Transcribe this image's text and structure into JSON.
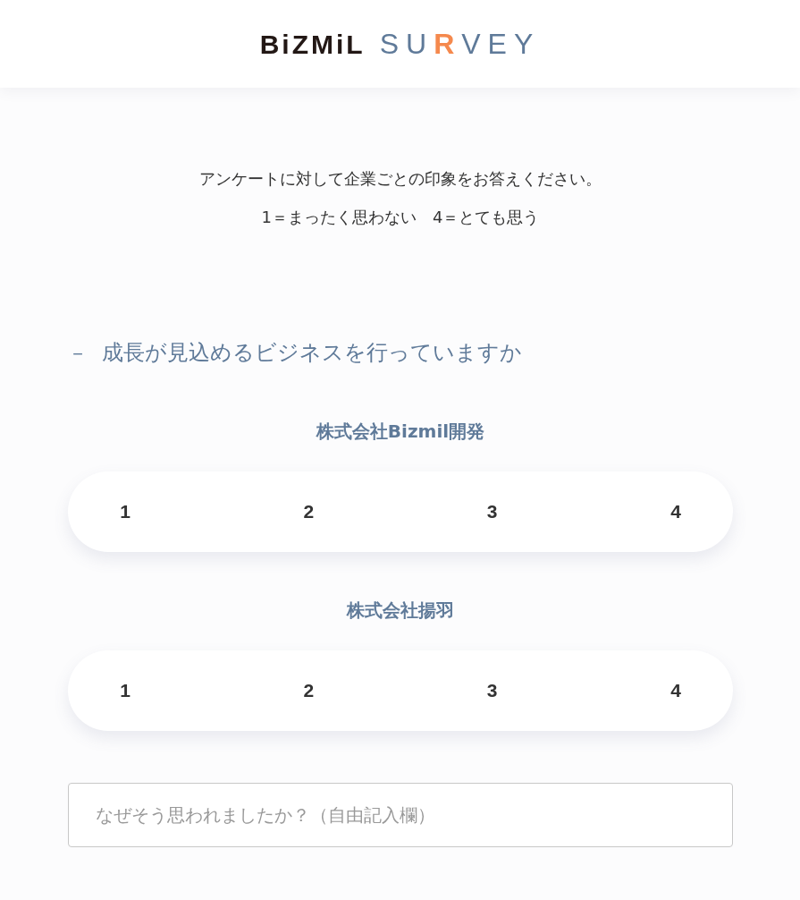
{
  "logo": {
    "brand": "BiZMiL",
    "product": [
      {
        "text": "SU",
        "accent": false
      },
      {
        "text": "R",
        "accent": true
      },
      {
        "text": "VEY",
        "accent": false
      }
    ]
  },
  "intro": [
    "アンケートに対して企業ごとの印象をお答えください。",
    "1＝まったく思わない　4＝とても思う"
  ],
  "question": {
    "marker": "－",
    "title": "成長が見込めるビジネスを行っていますか",
    "expanded": true,
    "companies": [
      {
        "name": "株式会社Bizmil開発",
        "options": [
          {
            "label": "1",
            "selected": false
          },
          {
            "label": "2",
            "selected": false
          },
          {
            "label": "3",
            "selected": false
          },
          {
            "label": "4",
            "selected": false
          }
        ]
      },
      {
        "name": "株式会社揚羽",
        "options": [
          {
            "label": "1",
            "selected": false
          },
          {
            "label": "2",
            "selected": false
          },
          {
            "label": "3",
            "selected": false
          },
          {
            "label": "4",
            "selected": false
          }
        ]
      }
    ],
    "comment": {
      "placeholder": "なぜそう思われましたか？（自由記入欄）"
    }
  }
}
